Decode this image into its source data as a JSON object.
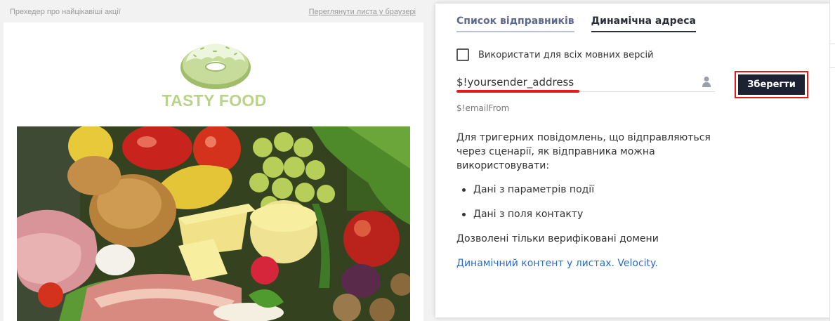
{
  "email_preview": {
    "preheader": "Прехедер про найцікавіші акції",
    "view_in_browser": "Переглянути листа у браузері",
    "logo_text": "TASTY FOOD",
    "logo_icon": "donut-icon",
    "brand_color": "#b9d38b"
  },
  "panel": {
    "tabs": [
      {
        "label": "Список відправників",
        "active": false
      },
      {
        "label": "Динамічна адреса",
        "active": true
      }
    ],
    "checkbox_label": "Використати для всіх мовних версій",
    "checkbox_checked": false,
    "address_value": "$!yoursender_address",
    "address_icon": "user-icon",
    "hint": "$!emailFrom",
    "save_label": "Зберегти",
    "description": "Для тригерних повідомлень, що відправляються через сценарії, як відправника можна використовувати:",
    "bullets": [
      "Дані з параметрів події",
      "Дані з поля контакту"
    ],
    "allowed_note": "Дозволені тільки верифіковані домени",
    "doc_link": "Динамічний контент у листах. Velocity.",
    "colors": {
      "primary_button": "#1d2233",
      "highlight": "#e41b1b",
      "link": "#2d6ac8"
    }
  }
}
